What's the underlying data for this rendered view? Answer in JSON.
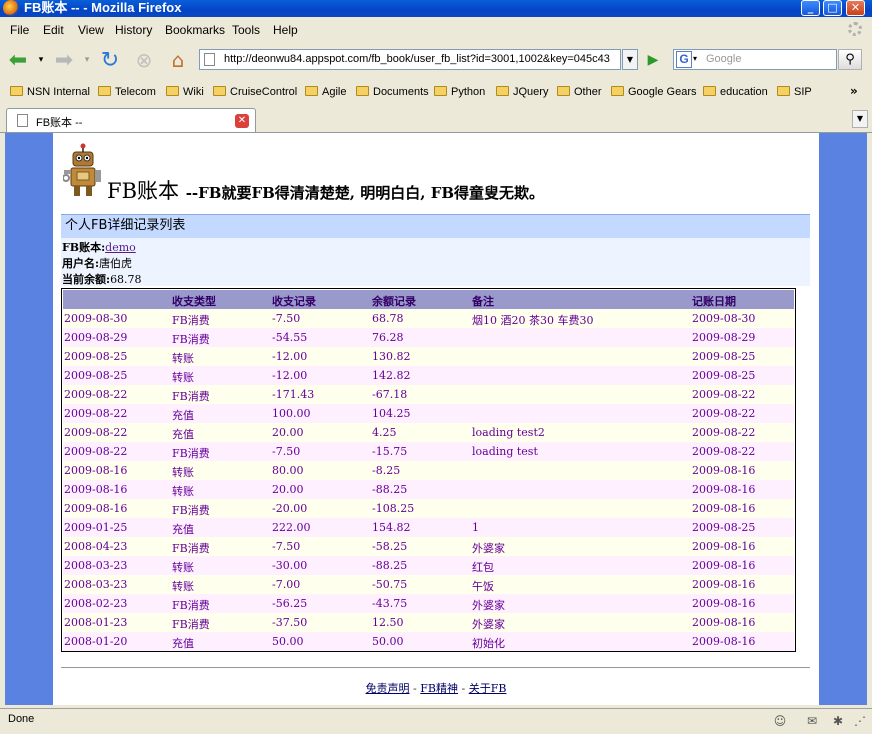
{
  "window": {
    "title": "FB账本 -- - Mozilla Firefox"
  },
  "menu": [
    "File",
    "Edit",
    "View",
    "History",
    "Bookmarks",
    "Tools",
    "Help"
  ],
  "nav": {
    "url": "http://deonwu84.appspot.com/fb_book/user_fb_list?id=3001,1002&key=045c43",
    "search_placeholder": "Google",
    "search_engine_letter": "G"
  },
  "bookmarks": [
    "NSN Internal",
    "Telecom",
    "Wiki",
    "CruiseControl",
    "Agile",
    "Documents",
    "Python",
    "JQuery",
    "Other",
    "Google Gears",
    "education",
    "SIP"
  ],
  "tab": {
    "label": "FB账本 --"
  },
  "page": {
    "title": "FB账本",
    "subtitle": "--FB就要FB得清清楚楚, 明明白白, FB得童叟无欺。",
    "section": "个人FB详细记录列表",
    "account_label": "FB账本:",
    "account_value": "demo",
    "user_label": "用户名:",
    "user_value": "唐伯虎",
    "balance_label": "当前余额:",
    "balance_value": "68.78"
  },
  "table": {
    "headers": [
      "",
      "收支类型",
      "收支记录",
      "余额记录",
      "备注",
      "记账日期"
    ],
    "rows": [
      [
        "2009-08-30",
        "FB消费",
        "-7.50",
        "68.78",
        "烟10 酒20 茶30 车费30",
        "2009-08-30"
      ],
      [
        "2009-08-29",
        "FB消费",
        "-54.55",
        "76.28",
        "",
        "2009-08-29"
      ],
      [
        "2009-08-25",
        "转账",
        "-12.00",
        "130.82",
        "",
        "2009-08-25"
      ],
      [
        "2009-08-25",
        "转账",
        "-12.00",
        "142.82",
        "",
        "2009-08-25"
      ],
      [
        "2009-08-22",
        "FB消费",
        "-171.43",
        "-67.18",
        "",
        "2009-08-22"
      ],
      [
        "2009-08-22",
        "充值",
        "100.00",
        "104.25",
        "",
        "2009-08-22"
      ],
      [
        "2009-08-22",
        "充值",
        "20.00",
        "4.25",
        "loading test2",
        "2009-08-22"
      ],
      [
        "2009-08-22",
        "FB消费",
        "-7.50",
        "-15.75",
        "loading test",
        "2009-08-22"
      ],
      [
        "2009-08-16",
        "转账",
        "80.00",
        "-8.25",
        "",
        "2009-08-16"
      ],
      [
        "2009-08-16",
        "转账",
        "20.00",
        "-88.25",
        "",
        "2009-08-16"
      ],
      [
        "2009-08-16",
        "FB消费",
        "-20.00",
        "-108.25",
        "",
        "2009-08-16"
      ],
      [
        "2009-01-25",
        "充值",
        "222.00",
        "154.82",
        "1",
        "2009-08-25"
      ],
      [
        "2008-04-23",
        "FB消费",
        "-7.50",
        "-58.25",
        "外婆家",
        "2009-08-16"
      ],
      [
        "2008-03-23",
        "转账",
        "-30.00",
        "-88.25",
        "红包",
        "2009-08-16"
      ],
      [
        "2008-03-23",
        "转账",
        "-7.00",
        "-50.75",
        "午饭",
        "2009-08-16"
      ],
      [
        "2008-02-23",
        "FB消费",
        "-56.25",
        "-43.75",
        "外婆家",
        "2009-08-16"
      ],
      [
        "2008-01-23",
        "FB消费",
        "-37.50",
        "12.50",
        "外婆家",
        "2009-08-16"
      ],
      [
        "2008-01-20",
        "充值",
        "50.00",
        "50.00",
        "初始化",
        "2009-08-16"
      ]
    ]
  },
  "footer": {
    "links": [
      "免责声明",
      "FB精神",
      "关于FB"
    ],
    "separator": " - "
  },
  "status": {
    "text": "Done"
  }
}
